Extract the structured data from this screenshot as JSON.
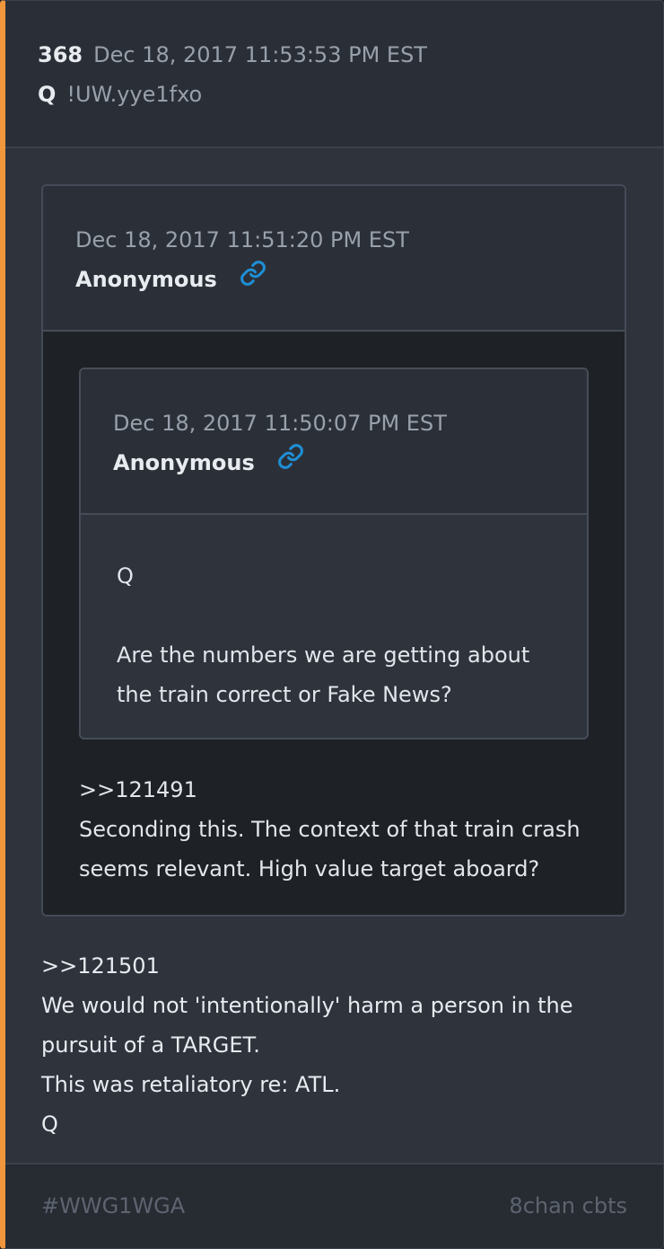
{
  "post": {
    "number": "368",
    "timestamp": "Dec 18, 2017 11:53:53 PM EST",
    "author": "Q",
    "tripcode": "!UW.yye1fxo",
    "accent_color": "#f0973e"
  },
  "quote_outer": {
    "timestamp": "Dec 18, 2017 11:51:20 PM EST",
    "author": "Anonymous",
    "link_icon": "link-icon",
    "lines": [
      ">>121491",
      "Seconding this. The context of that train crash",
      "seems relevant. High value target aboard?"
    ]
  },
  "quote_inner": {
    "timestamp": "Dec 18, 2017 11:50:07 PM EST",
    "author": "Anonymous",
    "link_icon": "link-icon",
    "paragraph1": "Q",
    "paragraph2": "Are the numbers we are getting about the train correct or Fake News?"
  },
  "body": {
    "lines": [
      ">>121501",
      "We would not 'intentionally' harm a person in the",
      "pursuit of a TARGET.",
      "This was retaliatory re: ATL.",
      "Q"
    ]
  },
  "footer": {
    "tag": "#WWG1WGA",
    "source": "8chan cbts"
  },
  "colors": {
    "link": "#1f8fd6",
    "card_background": "#2e333c",
    "quote_background": "#1e2126"
  }
}
